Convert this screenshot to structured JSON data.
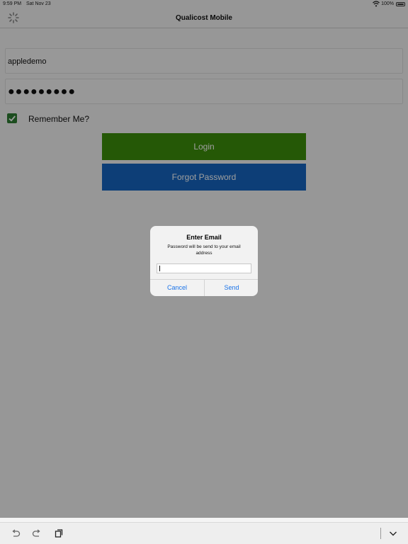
{
  "status_bar": {
    "time": "9:59 PM",
    "date": "Sat Nov 23",
    "battery_pct": "100%",
    "icons": [
      "wifi-icon",
      "battery-icon"
    ]
  },
  "nav": {
    "title": "Qualicost Mobile",
    "left_icon": "refresh-icon"
  },
  "login_form": {
    "username_value": "appledemo",
    "password_value": "●●●●●●●●●",
    "remember_label": "Remember Me?",
    "remember_checked": true,
    "login_label": "Login",
    "forgot_label": "Forgot Password"
  },
  "dialog": {
    "title": "Enter Email",
    "message": "Password will be send to your email address",
    "input_value": "",
    "cancel_label": "Cancel",
    "send_label": "Send"
  },
  "toolbar": {
    "icons": [
      "undo-icon",
      "redo-icon",
      "clipboard-icon",
      "chevron-down-icon"
    ]
  },
  "colors": {
    "login_button": "#3d8e0b",
    "forgot_button": "#1565c0",
    "checkbox": "#2e7d32",
    "dialog_button_text": "#1a73e8"
  }
}
